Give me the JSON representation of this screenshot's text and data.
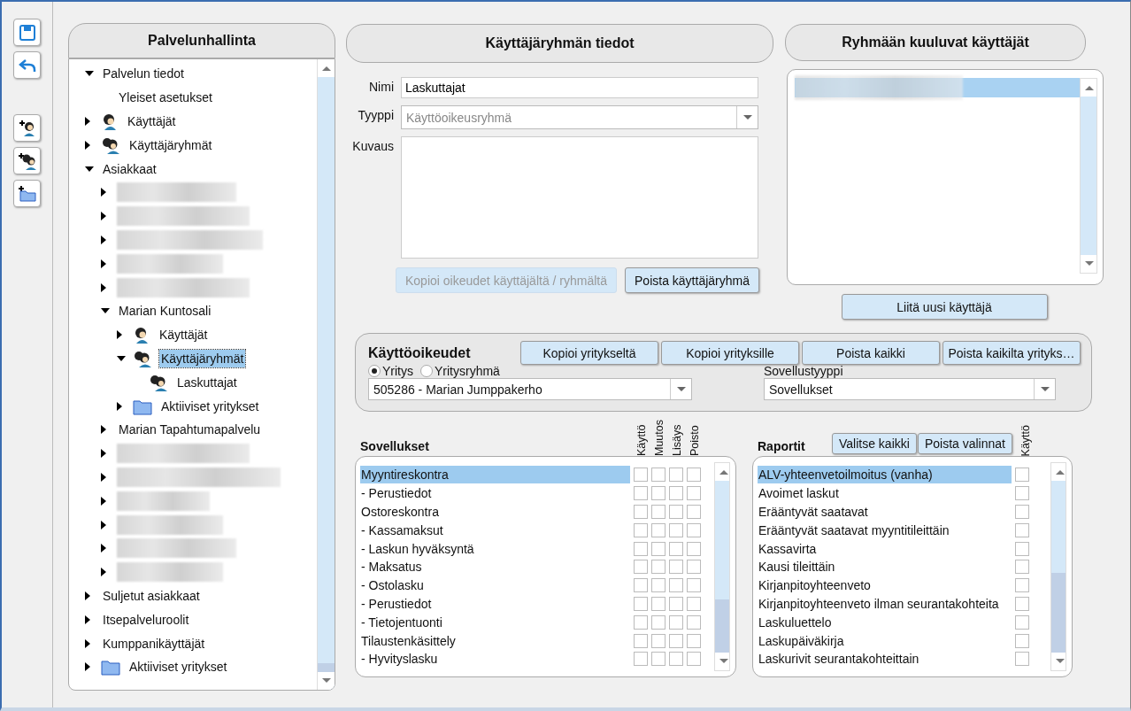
{
  "toolbar": [
    {
      "kind": "save"
    },
    {
      "kind": "undo"
    },
    {
      "kind": "add-user"
    },
    {
      "kind": "add-group"
    },
    {
      "kind": "add-folder"
    }
  ],
  "service_panel": {
    "title": "Palvelunhallinta",
    "tree": [
      {
        "kind": "plain",
        "label": "Palvelun tiedot",
        "expanded": true,
        "selected": false,
        "children": [
          {
            "kind": "plain",
            "label": "Yleiset asetukset",
            "selected": false
          }
        ]
      },
      {
        "kind": "user",
        "label": "Käyttäjät",
        "expanded": false,
        "selected": false
      },
      {
        "kind": "group",
        "label": "Käyttäjäryhmät",
        "expanded": false,
        "selected": false
      },
      {
        "kind": "plain",
        "label": "Asiakkaat",
        "expanded": true,
        "selected": false,
        "children": [
          {
            "kind": "redacted",
            "expanded": false
          },
          {
            "kind": "redacted",
            "expanded": false
          },
          {
            "kind": "redacted",
            "expanded": false
          },
          {
            "kind": "redacted",
            "expanded": false
          },
          {
            "kind": "redacted",
            "expanded": false
          },
          {
            "kind": "plain",
            "label": "Marian Kuntosali",
            "expanded": true,
            "selected": false,
            "children": [
              {
                "kind": "user",
                "label": "Käyttäjät",
                "expanded": false,
                "selected": false
              },
              {
                "kind": "group",
                "label": "Käyttäjäryhmät",
                "expanded": true,
                "selected": true,
                "children": [
                  {
                    "kind": "group",
                    "label": "Laskuttajat",
                    "selected": false
                  }
                ]
              },
              {
                "kind": "folder",
                "label": "Aktiiviset yritykset",
                "expanded": false,
                "selected": false
              }
            ]
          },
          {
            "kind": "plain",
            "label": "Marian Tapahtumapalvelu",
            "expanded": false,
            "selected": false
          },
          {
            "kind": "redacted",
            "expanded": false
          },
          {
            "kind": "redacted",
            "expanded": false
          },
          {
            "kind": "redacted",
            "expanded": false
          },
          {
            "kind": "redacted",
            "expanded": false
          },
          {
            "kind": "redacted",
            "expanded": false
          },
          {
            "kind": "redacted",
            "expanded": false
          }
        ]
      },
      {
        "kind": "plain",
        "label": "Suljetut asiakkaat",
        "expanded": false,
        "selected": false
      },
      {
        "kind": "plain",
        "label": "Itsepalveluroolit",
        "expanded": false,
        "selected": false
      },
      {
        "kind": "plain",
        "label": "Kumppanikäyttäjät",
        "expanded": false,
        "selected": false
      },
      {
        "kind": "folder",
        "label": "Aktiiviset yritykset",
        "expanded": false,
        "selected": false
      }
    ]
  },
  "group_details": {
    "title": "Käyttäjäryhmän tiedot",
    "name": {
      "label": "Nimi",
      "value": "Laskuttajat"
    },
    "type": {
      "label": "Tyyppi",
      "value": "Käyttöoikeusryhmä",
      "disabled": true
    },
    "description": {
      "label": "Kuvaus"
    },
    "buttons": [
      {
        "label": "Kopioi oikeudet käyttäjältä / ryhmältä",
        "disabled": true
      },
      {
        "label": "Poista käyttäjäryhmä",
        "disabled": false
      }
    ]
  },
  "group_users": {
    "title": "Ryhmään kuuluvat käyttäjät",
    "users": [
      {
        "kind": "redacted",
        "selected": true
      }
    ],
    "add_button": "Liitä uusi käyttäjä"
  },
  "permissions": {
    "title": "Käyttöoikeudet",
    "buttons": [
      "Kopioi yritykseltä",
      "Kopioi yrityksille",
      "Poista kaikki",
      "Poista kaikilta yrityks…"
    ],
    "scope": [
      {
        "label": "Yritys",
        "selected": true
      },
      {
        "label": "Yritysryhmä",
        "selected": false
      }
    ],
    "company": "505286 - Marian Jumppakerho",
    "app_type": {
      "label": "Sovellustyyppi",
      "value": "Sovellukset"
    }
  },
  "applications": {
    "title": "Sovellukset",
    "columns": [
      "Käyttö",
      "Muutos",
      "Lisäys",
      "Poisto"
    ],
    "rows": [
      {
        "label": "Myyntireskontra",
        "selected": true,
        "checks": [
          false,
          false,
          false,
          false
        ]
      },
      {
        "label": "- Perustiedot",
        "selected": false,
        "checks": [
          false,
          false,
          false,
          false
        ]
      },
      {
        "label": "Ostoreskontra",
        "selected": false,
        "checks": [
          false,
          false,
          false,
          false
        ]
      },
      {
        "label": "- Kassamaksut",
        "selected": false,
        "checks": [
          false,
          false,
          false,
          false
        ]
      },
      {
        "label": "- Laskun hyväksyntä",
        "selected": false,
        "checks": [
          false,
          false,
          false,
          false
        ]
      },
      {
        "label": "- Maksatus",
        "selected": false,
        "checks": [
          false,
          false,
          false,
          false
        ]
      },
      {
        "label": "- Ostolasku",
        "selected": false,
        "checks": [
          false,
          false,
          false,
          false
        ]
      },
      {
        "label": "- Perustiedot",
        "selected": false,
        "checks": [
          false,
          false,
          false,
          false
        ]
      },
      {
        "label": "- Tietojentuonti",
        "selected": false,
        "checks": [
          false,
          false,
          false,
          false
        ]
      },
      {
        "label": "Tilaustenkäsittely",
        "selected": false,
        "checks": [
          false,
          false,
          false,
          false
        ]
      },
      {
        "label": "- Hyvityslasku",
        "selected": false,
        "checks": [
          false,
          false,
          false,
          false
        ]
      }
    ]
  },
  "reports": {
    "title": "Raportit",
    "buttons": [
      "Valitse kaikki",
      "Poista valinnat"
    ],
    "columns": [
      "Käyttö"
    ],
    "rows": [
      {
        "label": "ALV-yhteenvetoilmoitus (vanha)",
        "selected": true,
        "checks": [
          false
        ]
      },
      {
        "label": "Avoimet laskut",
        "selected": false,
        "checks": [
          false
        ]
      },
      {
        "label": "Erääntyvät saatavat",
        "selected": false,
        "checks": [
          false
        ]
      },
      {
        "label": "Erääntyvät saatavat myyntitileittäin",
        "selected": false,
        "checks": [
          false
        ]
      },
      {
        "label": "Kassavirta",
        "selected": false,
        "checks": [
          false
        ]
      },
      {
        "label": "Kausi tileittäin",
        "selected": false,
        "checks": [
          false
        ]
      },
      {
        "label": "Kirjanpitoyhteenveto",
        "selected": false,
        "checks": [
          false
        ]
      },
      {
        "label": "Kirjanpitoyhteenveto ilman seurantakohteita",
        "selected": false,
        "checks": [
          false
        ]
      },
      {
        "label": "Laskuluettelo",
        "selected": false,
        "checks": [
          false
        ]
      },
      {
        "label": "Laskupäiväkirja",
        "selected": false,
        "checks": [
          false
        ]
      },
      {
        "label": "Laskurivit seurantakohteittain",
        "selected": false,
        "checks": [
          false
        ]
      }
    ]
  }
}
